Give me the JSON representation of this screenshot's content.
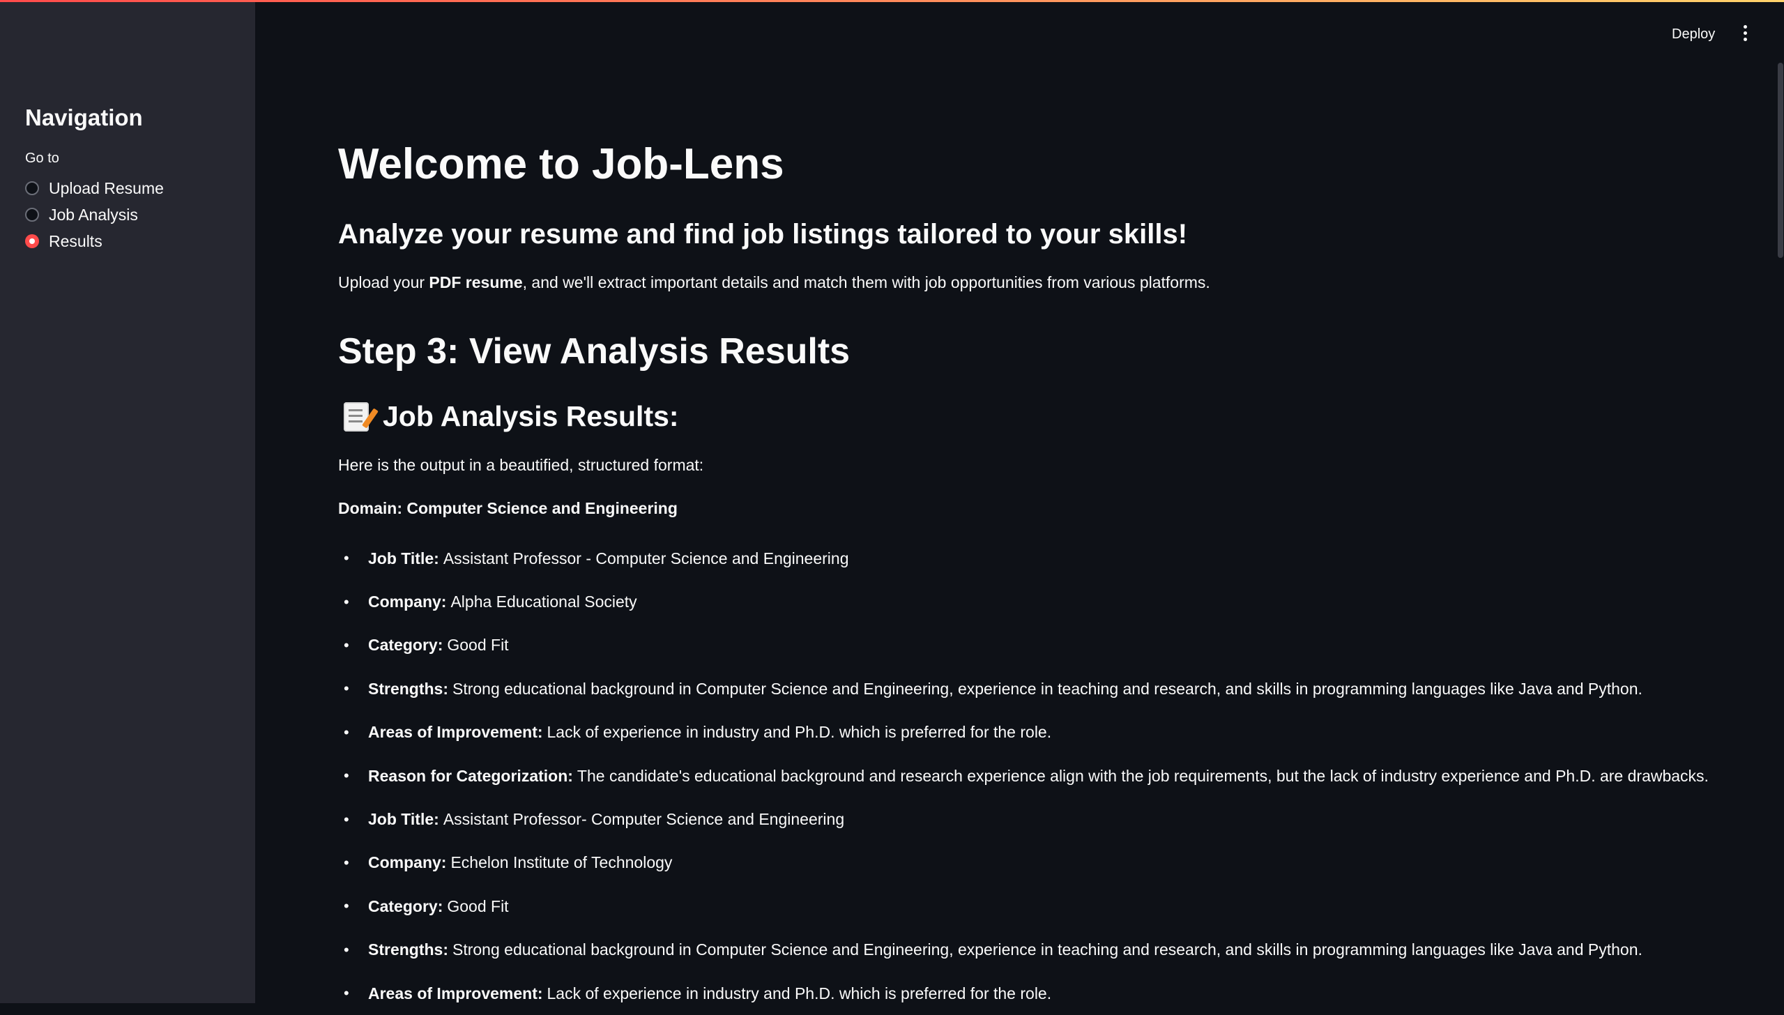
{
  "sidebar": {
    "title": "Navigation",
    "goto_label": "Go to",
    "options": [
      {
        "label": "Upload Resume",
        "selected": false
      },
      {
        "label": "Job Analysis",
        "selected": false
      },
      {
        "label": "Results",
        "selected": true
      }
    ]
  },
  "header": {
    "deploy_label": "Deploy",
    "menu_icon": "kebab-menu-icon"
  },
  "main": {
    "title": "Welcome to Job-Lens",
    "subtitle": "Analyze your resume and find job listings tailored to your skills!",
    "intro": {
      "before": "Upload your ",
      "bold": "PDF resume",
      "after": ", and we'll extract important details and match them with job opportunities from various platforms."
    },
    "step_heading": "Step 3: View Analysis Results",
    "results_heading": "Job Analysis Results:",
    "results_icon": "memo-icon",
    "output_intro": "Here is the output in a beautified, structured format:",
    "domain": "Domain: Computer Science and Engineering",
    "items": [
      {
        "key": "Job Title:",
        "value": "Assistant Professor - Computer Science and Engineering"
      },
      {
        "key": "Company:",
        "value": "Alpha Educational Society"
      },
      {
        "key": "Category:",
        "value": "Good Fit"
      },
      {
        "key": "Strengths:",
        "value": "Strong educational background in Computer Science and Engineering, experience in teaching and research, and skills in programming languages like Java and Python."
      },
      {
        "key": "Areas of Improvement:",
        "value": "Lack of experience in industry and Ph.D. which is preferred for the role."
      },
      {
        "key": "Reason for Categorization:",
        "value": "The candidate's educational background and research experience align with the job requirements, but the lack of industry experience and Ph.D. are drawbacks."
      },
      {
        "key": "Job Title:",
        "value": "Assistant Professor- Computer Science and Engineering"
      },
      {
        "key": "Company:",
        "value": "Echelon Institute of Technology"
      },
      {
        "key": "Category:",
        "value": "Good Fit"
      },
      {
        "key": "Strengths:",
        "value": "Strong educational background in Computer Science and Engineering, experience in teaching and research, and skills in programming languages like Java and Python."
      },
      {
        "key": "Areas of Improvement:",
        "value": "Lack of experience in industry and Ph.D. which is preferred for the role."
      }
    ]
  },
  "colors": {
    "accent": "#ff4b4b",
    "background": "#0e1117",
    "sidebar": "#262730",
    "text": "#fafafa"
  }
}
